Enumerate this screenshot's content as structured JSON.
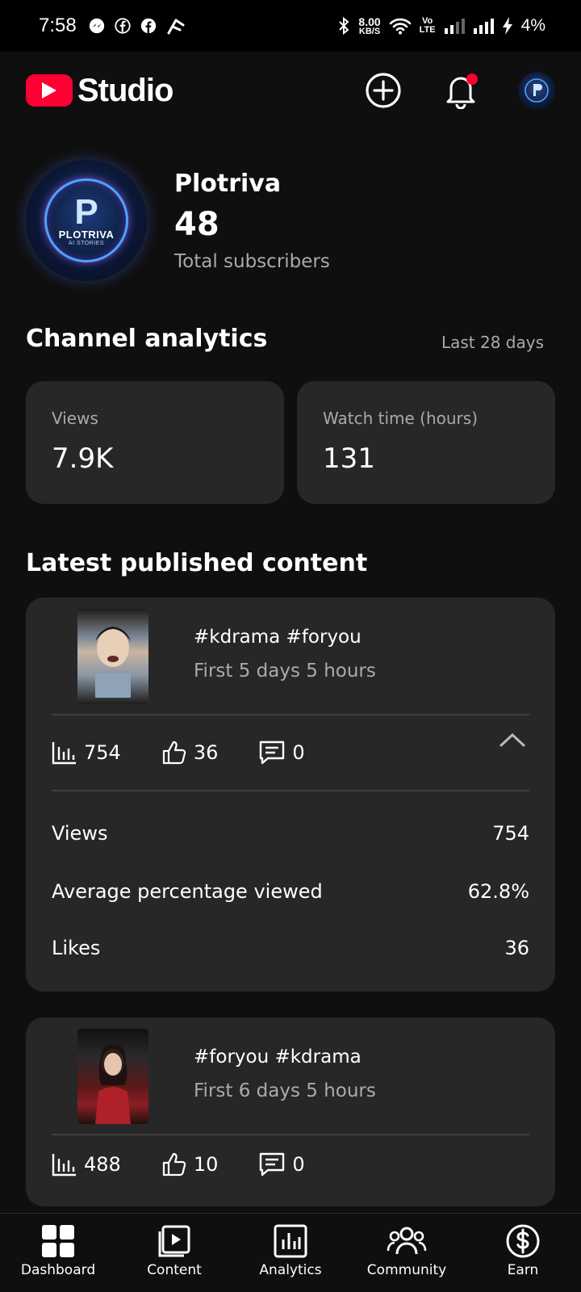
{
  "status_bar": {
    "time": "7:58",
    "net_speed_value": "8.00",
    "net_speed_unit": "KB/S",
    "volte_top": "Vo",
    "volte_bottom": "LTE",
    "battery": "4%"
  },
  "app": {
    "logo_text": "Studio",
    "icons": [
      "plus-circle-icon",
      "bell-icon",
      "channel-avatar"
    ],
    "accent_color": "#ff0033"
  },
  "channel": {
    "name": "Plotriva",
    "avatar_letter": "P",
    "avatar_name": "PLOTRIVA",
    "avatar_tagline": "AI STORIES",
    "subscribers": "48",
    "subscribers_label": "Total subscribers"
  },
  "analytics": {
    "title": "Channel analytics",
    "range": "Last 28 days",
    "views_label": "Views",
    "views_value": "7.9K",
    "watch_label": "Watch time (hours)",
    "watch_value": "131"
  },
  "latest": {
    "title": "Latest published content",
    "videos": [
      {
        "title": "#kdrama #foryou",
        "age": "First 5 days 5 hours",
        "views": "754",
        "likes": "36",
        "comments": "0",
        "details": [
          {
            "label": "Views",
            "value": "754"
          },
          {
            "label": "Average percentage viewed",
            "value": "62.8%"
          },
          {
            "label": "Likes",
            "value": "36"
          }
        ]
      },
      {
        "title": "#foryou #kdrama",
        "age": "First 6 days 5 hours",
        "views": "488",
        "likes": "10",
        "comments": "0"
      }
    ]
  },
  "nav": {
    "items": [
      {
        "label": "Dashboard",
        "icon": "dashboard-icon"
      },
      {
        "label": "Content",
        "icon": "content-icon"
      },
      {
        "label": "Analytics",
        "icon": "analytics-icon"
      },
      {
        "label": "Community",
        "icon": "community-icon"
      },
      {
        "label": "Earn",
        "icon": "earn-icon"
      }
    ]
  }
}
